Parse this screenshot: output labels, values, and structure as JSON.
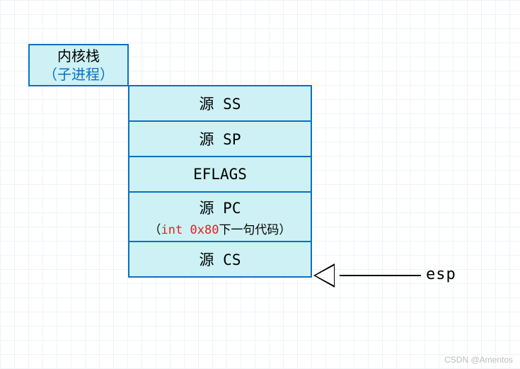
{
  "header": {
    "title": "内核栈",
    "subtitle": "（子进程）"
  },
  "stack": [
    {
      "label": "源 SS"
    },
    {
      "label": "源 SP"
    },
    {
      "label": "EFLAGS"
    },
    {
      "label": "源 PC",
      "sub_prefix": "（",
      "sub_code": "int 0x80",
      "sub_suffix": "下一句代码）"
    },
    {
      "label": "源 CS"
    }
  ],
  "pointer": {
    "label": "esp"
  },
  "watermark": "CSDN @Amentos"
}
